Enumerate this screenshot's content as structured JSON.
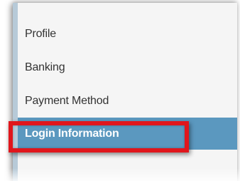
{
  "menu": {
    "items": [
      {
        "label": "Profile",
        "active": false
      },
      {
        "label": "Banking",
        "active": false
      },
      {
        "label": "Payment Method",
        "active": false
      },
      {
        "label": "Login Information",
        "active": true
      }
    ]
  },
  "colors": {
    "active_background": "#5b98bf",
    "annotation_border": "#e0161c",
    "panel_background": "#f5f5f5",
    "panel_accent": "#b7cad8"
  }
}
